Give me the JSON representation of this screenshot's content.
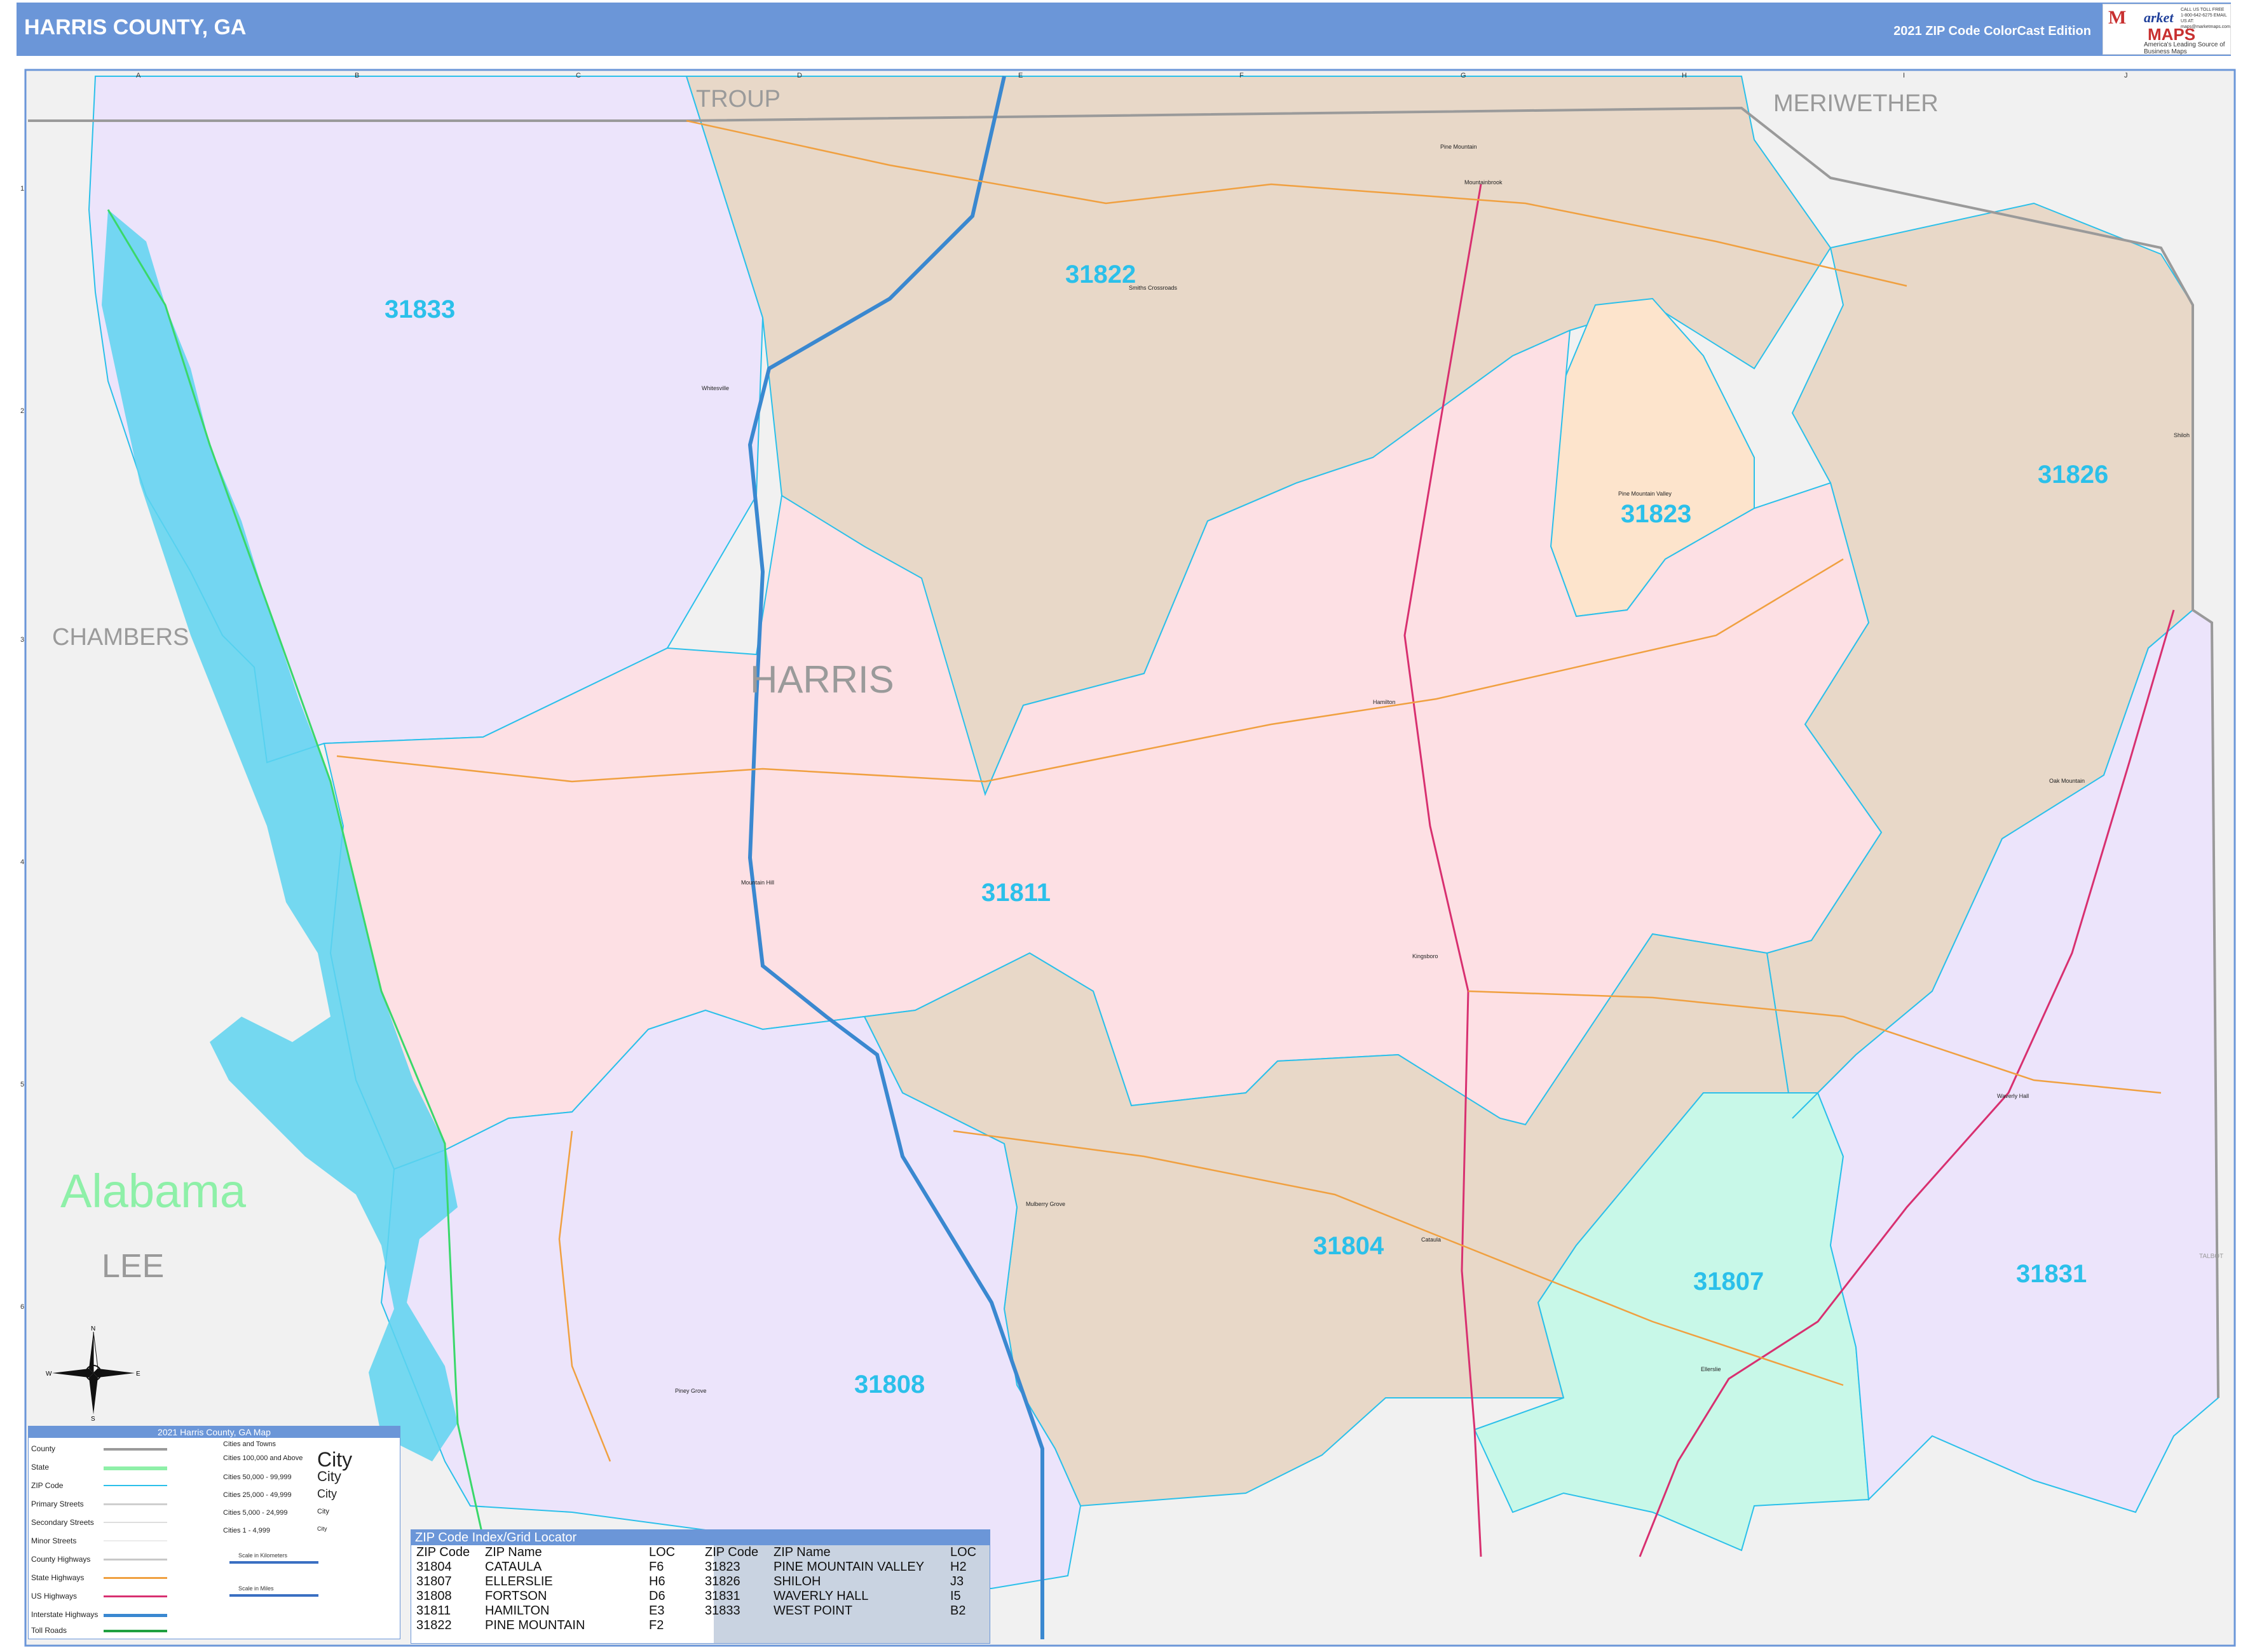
{
  "header": {
    "title": "HARRIS COUNTY, GA",
    "edition": "2021 ZIP Code ColorCast Edition"
  },
  "logo": {
    "line1": "M",
    "line2": "arket",
    "line3": "MAPS",
    "line4": "America's Leading Source of Business Maps",
    "side_text": "CALL US TOLL FREE 1-800-642-6275 EMAIL US AT: maps@marketmaps.com"
  },
  "map": {
    "county_labels": [
      {
        "id": "troup",
        "text": "TROUP"
      },
      {
        "id": "meriwether",
        "text": "MERIWETHER"
      },
      {
        "id": "chambers",
        "text": "CHAMBERS"
      },
      {
        "id": "harris",
        "text": "HARRIS"
      },
      {
        "id": "lee",
        "text": "LEE"
      },
      {
        "id": "talbot",
        "text": "TALBOT"
      }
    ],
    "state_label": "Alabama",
    "zip_labels": [
      "31833",
      "31822",
      "31823",
      "31826",
      "31811",
      "31804",
      "31808",
      "31807",
      "31831"
    ],
    "places": [
      "Pine Mountain",
      "Mountainbrook",
      "Smiths Crossroads",
      "Whitesville",
      "Pine Mountain Valley",
      "Shiloh",
      "Hamilton",
      "Oak Mountain",
      "Mountain Hill",
      "Kingsboro",
      "Waverly Hall",
      "Mulberry Grove",
      "Cataula",
      "Ellerslie",
      "Piney Grove"
    ],
    "grid_columns": [
      "A",
      "B",
      "C",
      "D",
      "E",
      "F",
      "G",
      "H",
      "I",
      "J"
    ],
    "grid_rows": [
      "1",
      "2",
      "3",
      "4",
      "5",
      "6"
    ]
  },
  "legend": {
    "title": "2021 Harris County, GA Map",
    "rows": [
      "County",
      "State",
      "ZIP Code",
      "Primary Streets",
      "Secondary Streets",
      "Minor Streets",
      "County Highways",
      "State Highways",
      "US Highways",
      "Interstate Highways",
      "Toll Roads"
    ],
    "cities_header": "Cities and Towns",
    "city_tiers": [
      "Cities 100,000 and Above",
      "Cities 50,000 - 99,999",
      "Cities 25,000 - 49,999",
      "Cities 5,000 - 24,999",
      "Cities 1 - 4,999"
    ],
    "city_samples": [
      "City",
      "City",
      "City",
      "City",
      "City"
    ],
    "scale_km": "Scale in Kilometers",
    "scale_mi": "Scale in Miles"
  },
  "compass": {
    "n": "N",
    "s": "S",
    "e": "E",
    "w": "W"
  },
  "zip_index": {
    "title": "ZIP Code Index/Grid Locator",
    "headers": [
      "ZIP Code",
      "ZIP Name",
      "LOC",
      "ZIP Code",
      "ZIP Name",
      "LOC"
    ],
    "left": [
      {
        "zip": "31804",
        "name": "CATAULA",
        "loc": "F6"
      },
      {
        "zip": "31807",
        "name": "ELLERSLIE",
        "loc": "H6"
      },
      {
        "zip": "31808",
        "name": "FORTSON",
        "loc": "D6"
      },
      {
        "zip": "31811",
        "name": "HAMILTON",
        "loc": "E3"
      },
      {
        "zip": "31822",
        "name": "PINE MOUNTAIN",
        "loc": "F2"
      }
    ],
    "right": [
      {
        "zip": "31823",
        "name": "PINE MOUNTAIN VALLEY",
        "loc": "H2"
      },
      {
        "zip": "31826",
        "name": "SHILOH",
        "loc": "J3"
      },
      {
        "zip": "31831",
        "name": "WAVERLY HALL",
        "loc": "I5"
      },
      {
        "zip": "31833",
        "name": "WEST POINT",
        "loc": "B2"
      }
    ]
  },
  "colors": {
    "header": "#6b96d8",
    "zip_31833": "#ece4fb",
    "zip_31822": "#e8d8c8",
    "zip_31811": "#fde0e4",
    "zip_31823": "#fde4cc",
    "zip_31804": "#e8d8c8",
    "zip_31808": "#ece4fb",
    "zip_31807": "#c8f8e8",
    "zip_31831": "#ece4fb",
    "outside": "#f1f1f1",
    "water": "#5ed4f0",
    "zip_label": "#2bc0ea",
    "zip_border": "#2bc0ea"
  }
}
